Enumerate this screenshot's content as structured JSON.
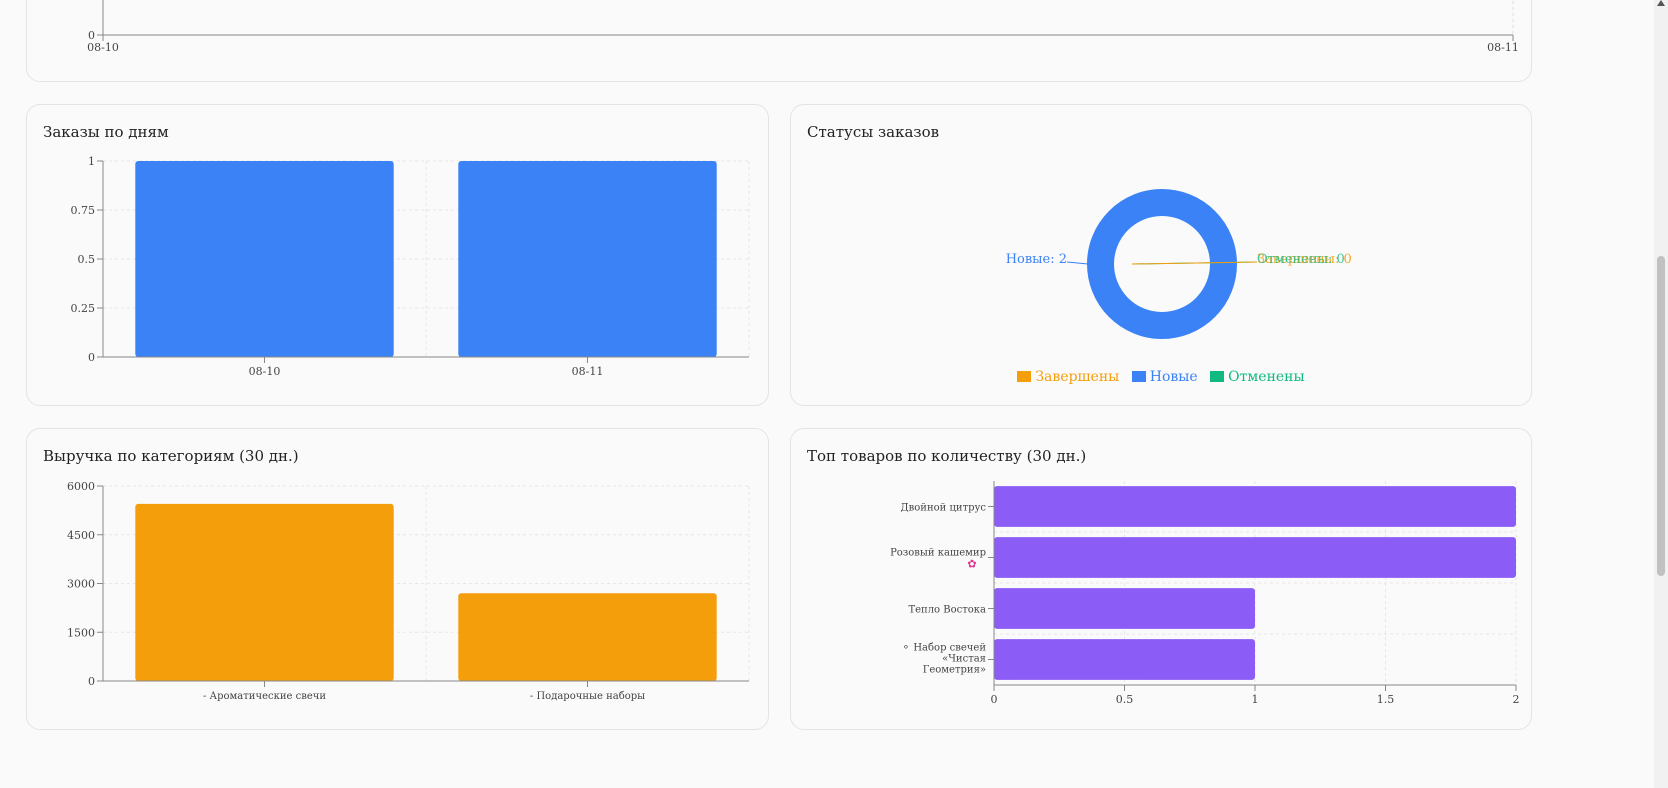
{
  "top_chart": {
    "y_zero": "0",
    "x_ticks": [
      "08-10",
      "08-11"
    ]
  },
  "orders_by_day": {
    "title": "Заказы по дням",
    "chart_data": {
      "type": "bar",
      "categories": [
        "08-10",
        "08-11"
      ],
      "values": [
        1,
        1
      ],
      "ylim": [
        0,
        1
      ],
      "yticks": [
        "0",
        "0.25",
        "0.5",
        "0.75",
        "1"
      ],
      "color": "#3b82f6"
    }
  },
  "order_status": {
    "title": "Статусы заказов",
    "chart_data": {
      "type": "pie",
      "labels": [
        "Завершены",
        "Новые",
        "Отменены"
      ],
      "values": [
        0,
        2,
        0
      ],
      "colors": [
        "#f59e0b",
        "#3b82f6",
        "#10b981"
      ],
      "slice_labels": [
        "Новые: 2",
        "Завершены: 0",
        "Отменены: 0"
      ]
    }
  },
  "revenue_by_category": {
    "title": "Выручка по категориям (30 дн.)",
    "chart_data": {
      "type": "bar",
      "categories": [
        "- Ароматические свечи",
        "- Подарочные наборы"
      ],
      "values": [
        5450,
        2700
      ],
      "ylim": [
        0,
        6000
      ],
      "yticks": [
        "0",
        "1500",
        "3000",
        "4500",
        "6000"
      ],
      "color": "#f59e0b"
    }
  },
  "top_products": {
    "title": "Топ товаров по количеству (30 дн.)",
    "chart_data": {
      "type": "bar",
      "orientation": "horizontal",
      "categories": [
        "Двойной цитрус",
        "Розовый кашемир",
        "Тепло Востока",
        "⚬ Набор свечей «Чистая Геометрия»"
      ],
      "values": [
        2,
        2,
        1,
        1
      ],
      "xlim": [
        0,
        2
      ],
      "xticks": [
        "0",
        "0.5",
        "1",
        "1.5",
        "2"
      ],
      "color": "#8b5cf6"
    }
  }
}
